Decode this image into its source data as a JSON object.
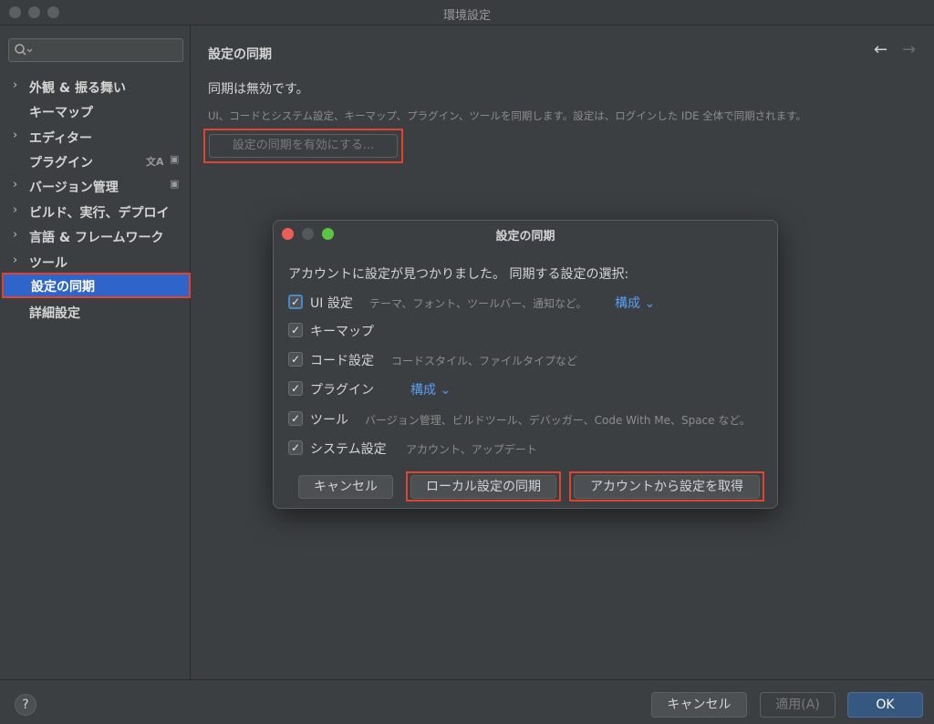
{
  "window": {
    "title": "環境設定"
  },
  "sidebar": {
    "search_placeholder": "",
    "items": [
      {
        "label": "外観 & 振る舞い",
        "chevron": "›"
      },
      {
        "label": "キーマップ",
        "chevron": ""
      },
      {
        "label": "エディター",
        "chevron": "›"
      },
      {
        "label": "プラグイン",
        "chevron": ""
      },
      {
        "label": "バージョン管理",
        "chevron": "›"
      },
      {
        "label": "ビルド、実行、デプロイ",
        "chevron": "›"
      },
      {
        "label": "言語 & フレームワーク",
        "chevron": "›"
      },
      {
        "label": "ツール",
        "chevron": "›"
      },
      {
        "label": "設定の同期",
        "chevron": ""
      },
      {
        "label": "詳細設定",
        "chevron": ""
      }
    ],
    "selected_index": 8,
    "translate_glyph": "文A",
    "project_glyph": "▣"
  },
  "main": {
    "title": "設定の同期",
    "status": "同期は無効です。",
    "description": "UI、コードとシステム設定、キーマップ、プラグイン、ツールを同期します。設定は、ログインした IDE 全体で同期されます。",
    "enable_button": "設定の同期を有効にする..."
  },
  "dialog": {
    "title": "設定の同期",
    "heading": "アカウントに設定が見つかりました。 同期する設定の選択:",
    "check_glyph": "✓",
    "rows": [
      {
        "name": "UI 設定",
        "hint": "テーマ、フォント、ツールバー、通知など。",
        "configure": "構成 ⌄",
        "checked": true
      },
      {
        "name": "キーマップ",
        "hint": "",
        "configure": "",
        "checked": true
      },
      {
        "name": "コード設定",
        "hint": "コードスタイル、ファイルタイプなど",
        "configure": "",
        "checked": true
      },
      {
        "name": "プラグイン",
        "hint": "",
        "configure": "構成 ⌄",
        "checked": true
      },
      {
        "name": "ツール",
        "hint": "バージョン管理、ビルドツール、デバッガー、Code With Me、Space など。",
        "configure": "",
        "checked": true
      },
      {
        "name": "システム設定",
        "hint": "アカウント、アップデート",
        "configure": "",
        "checked": true
      }
    ],
    "buttons": {
      "cancel": "キャンセル",
      "sync_local": "ローカル設定の同期",
      "get_from_account": "アカウントから設定を取得"
    }
  },
  "footer": {
    "help": "?",
    "cancel": "キャンセル",
    "apply": "適用(A)",
    "ok": "OK"
  },
  "colors": {
    "background": "#3c3f41",
    "selection": "#2f65ca",
    "highlight_border": "#e0442f",
    "link": "#589df6",
    "primary_button": "#365880"
  }
}
